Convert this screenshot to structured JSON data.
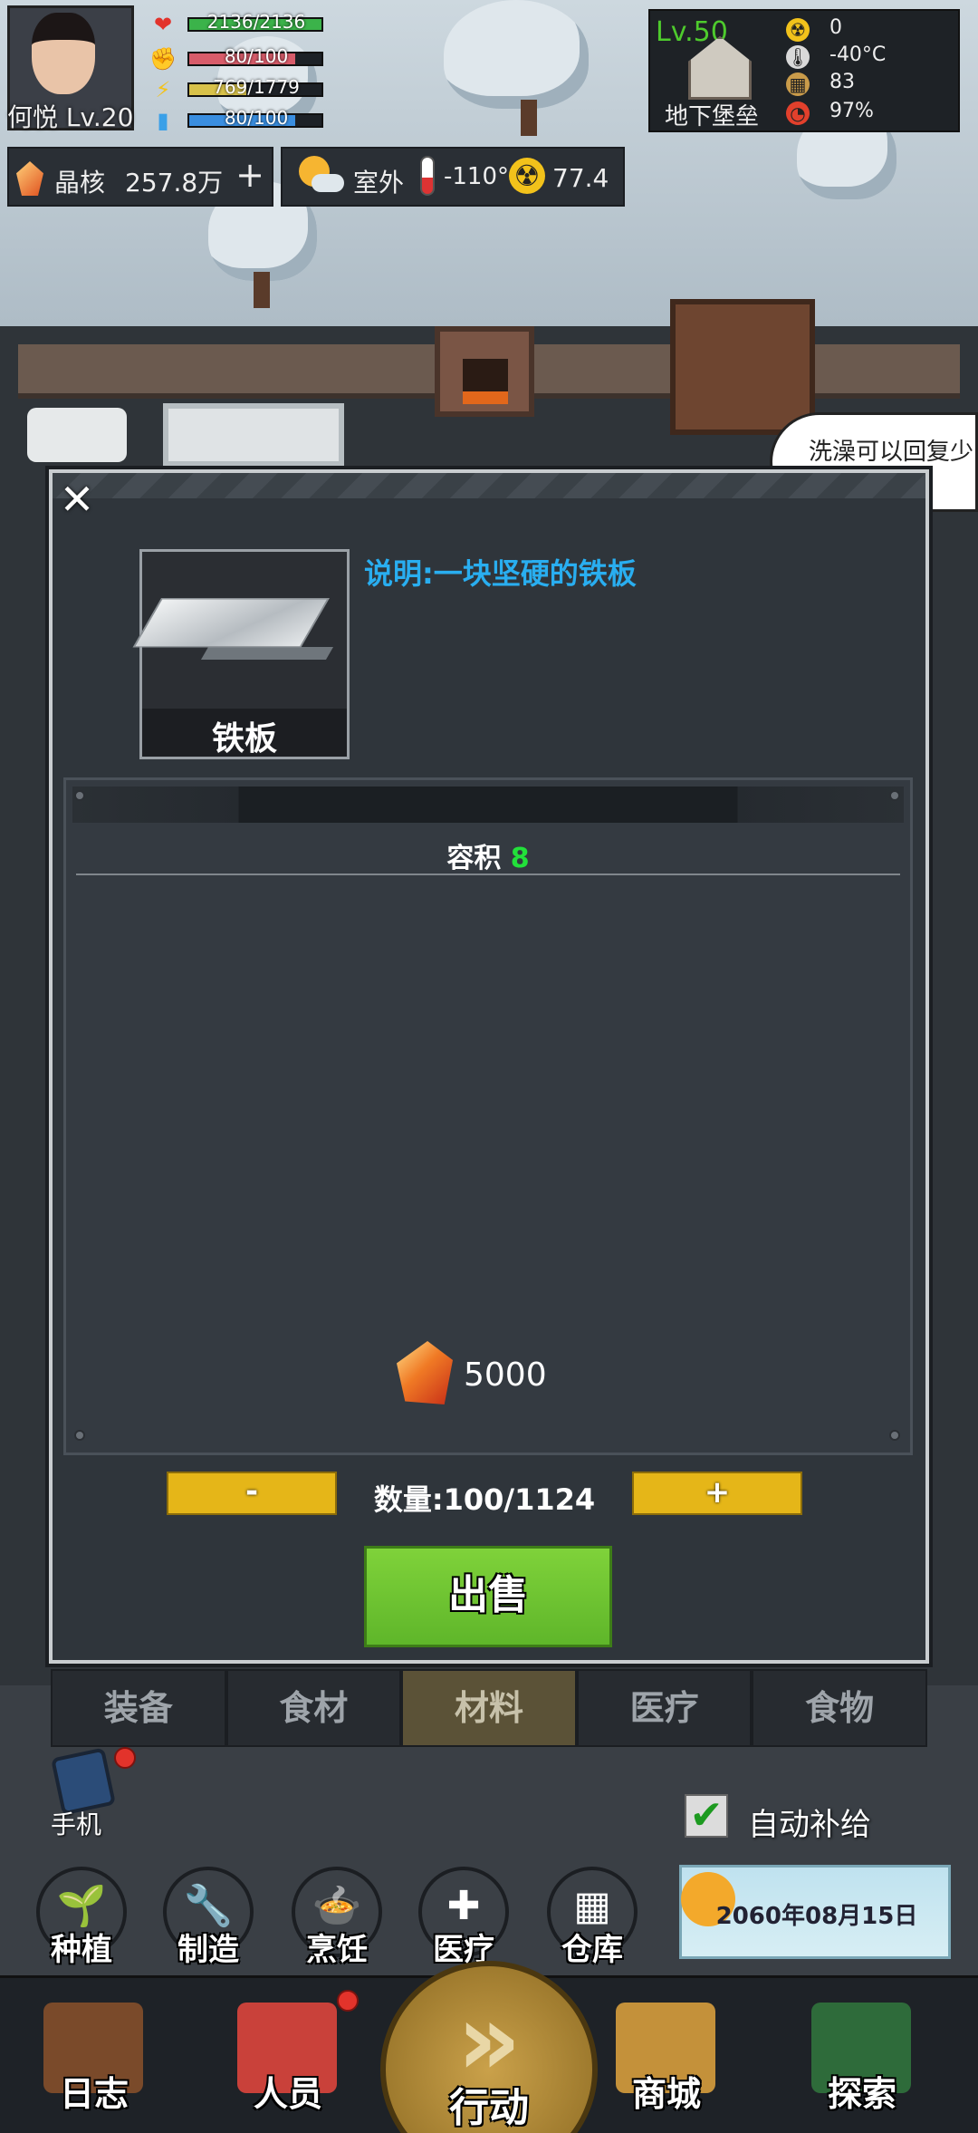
{
  "player": {
    "name": "何悦 Lv.20"
  },
  "stats": [
    {
      "icon": "heart-icon",
      "glyph": "❤",
      "color": "#e2332b",
      "text": "2136/2136",
      "fill": 1.0,
      "bar": "#3bb34a"
    },
    {
      "icon": "fist-icon",
      "glyph": "✊",
      "color": "#e8d4c0",
      "text": "80/100",
      "fill": 0.8,
      "bar": "#d85c6a"
    },
    {
      "icon": "lightning-icon",
      "glyph": "⚡",
      "color": "#f2c21b",
      "text": "769/1779",
      "fill": 0.43,
      "bar": "#d8c24a"
    },
    {
      "icon": "water-icon",
      "glyph": "▮",
      "color": "#3aa0e8",
      "text": "80/100",
      "fill": 0.8,
      "bar": "#3a8ee0"
    }
  ],
  "resources": {
    "crystal_label": "晶核",
    "crystal_value": "257.8万",
    "add": "+"
  },
  "outside": {
    "label": "室外",
    "temp": "-110°C",
    "radiation": "77.4"
  },
  "base": {
    "level": "Lv.50",
    "name": "地下堡垒",
    "rows": [
      {
        "icon": "radiation-icon",
        "glyph": "☢",
        "bg": "#f2c21b",
        "value": "0"
      },
      {
        "icon": "thermometer-icon",
        "glyph": "🌡",
        "bg": "#d9d9d9",
        "value": "-40°C"
      },
      {
        "icon": "supplies-icon",
        "glyph": "▦",
        "bg": "#c99b4a",
        "value": "83"
      },
      {
        "icon": "shield-icon",
        "glyph": "◔",
        "bg": "#e2402c",
        "value": "97%"
      }
    ]
  },
  "scene": {
    "speech": "洗澡可以回复少"
  },
  "modal": {
    "close": "✕",
    "item_name": "铁板",
    "description": "说明:一块坚硬的铁板",
    "volume_label": "容积",
    "volume_value": "8",
    "price": "5000",
    "qty_minus": "-",
    "qty_plus": "+",
    "quantity": "数量:100/1124",
    "sell": "出售"
  },
  "tabs": [
    {
      "label": "装备",
      "active": false
    },
    {
      "label": "食材",
      "active": false
    },
    {
      "label": "材料",
      "active": true
    },
    {
      "label": "医疗",
      "active": false
    },
    {
      "label": "食物",
      "active": false
    }
  ],
  "side": {
    "phone": "手机",
    "auto_supply": "自动补给",
    "date": "2060年08月15日"
  },
  "actions": [
    {
      "id": "plant",
      "label": "种植",
      "glyph": "🌱"
    },
    {
      "id": "craft",
      "label": "制造",
      "glyph": "🔧"
    },
    {
      "id": "cook",
      "label": "烹饪",
      "glyph": "🍲"
    },
    {
      "id": "medical",
      "label": "医疗",
      "glyph": "✚"
    },
    {
      "id": "storage",
      "label": "仓库",
      "glyph": "▦"
    }
  ],
  "nav": [
    {
      "id": "log",
      "label": "日志",
      "color": "#7a4a2a"
    },
    {
      "id": "people",
      "label": "人员",
      "color": "#c9413a"
    },
    {
      "id": "action",
      "label": "行动",
      "arrows": "»"
    },
    {
      "id": "shop",
      "label": "商城",
      "color": "#c4913a"
    },
    {
      "id": "explore",
      "label": "探索",
      "color": "#2e6b3a"
    }
  ]
}
